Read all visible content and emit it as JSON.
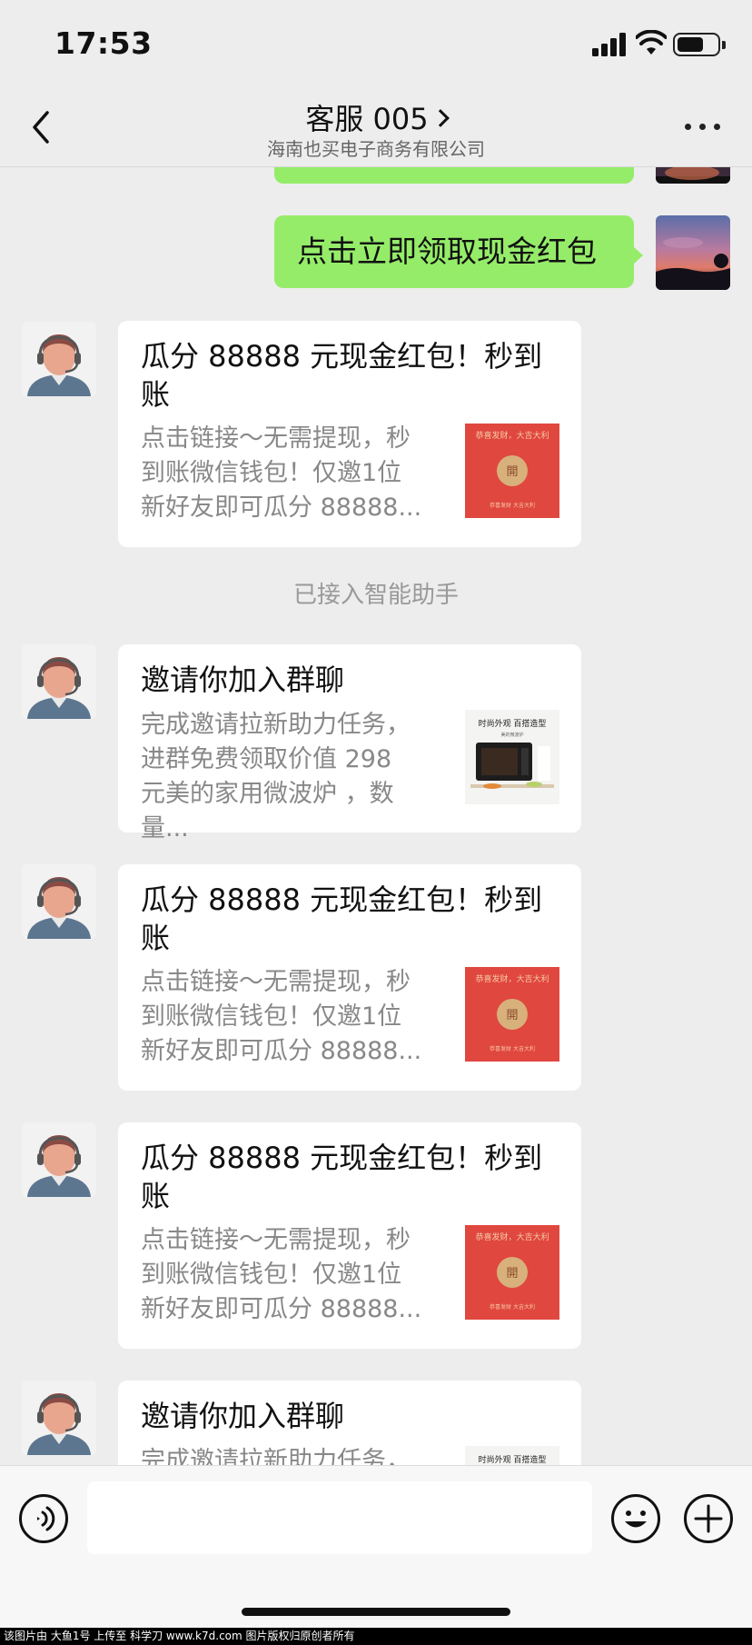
{
  "status_bar": {
    "time": "17:53"
  },
  "header": {
    "title": "客服 005",
    "subtitle": "海南也买电子商务有限公司"
  },
  "messages": {
    "self_top": {
      "text": "点击立即领取现金红包"
    },
    "card1": {
      "title": "瓜分 88888 元现金红包！秒到账",
      "desc": "点击链接～无需提现，秒到账微信钱包！仅邀1位新好友即可瓜分 88888..."
    },
    "system": {
      "text": "已接入智能助手"
    },
    "card2": {
      "title": "邀请你加入群聊",
      "desc": "完成邀请拉新助力任务，进群免费领取价值 298 元美的家用微波炉 ，数量..."
    },
    "card3": {
      "title": "瓜分 88888 元现金红包！秒到账",
      "desc": "点击链接～无需提现，秒到账微信钱包！仅邀1位新好友即可瓜分 88888..."
    },
    "card4": {
      "title": "瓜分 88888 元现金红包！秒到账",
      "desc": "点击链接～无需提现，秒到账微信钱包！仅邀1位新好友即可瓜分 88888..."
    },
    "card5": {
      "title": "邀请你加入群聊",
      "desc": "完成邀请拉新助力任务，"
    }
  },
  "thumbs": {
    "redpacket": {
      "line1": "恭喜发财，大吉大利",
      "button": "開",
      "footer": "恭喜发财 大吉大利"
    },
    "microwave": {
      "line1": "时尚外观 百搭造型",
      "line2": "美的微波炉"
    }
  },
  "input_bar": {
    "placeholder": ""
  },
  "watermark": {
    "text": "该图片由 大鱼1号 上传至 科学刀 www.k7d.com 图片版权归原创者所有"
  },
  "colors": {
    "bubble_self": "#95ec69",
    "background": "#ededed",
    "redpacket": "#e0473f"
  },
  "icons": [
    "back-arrow-icon",
    "more-dots-icon",
    "voice-icon",
    "emoji-icon",
    "plus-icon",
    "signal-icon",
    "wifi-icon",
    "battery-icon"
  ]
}
